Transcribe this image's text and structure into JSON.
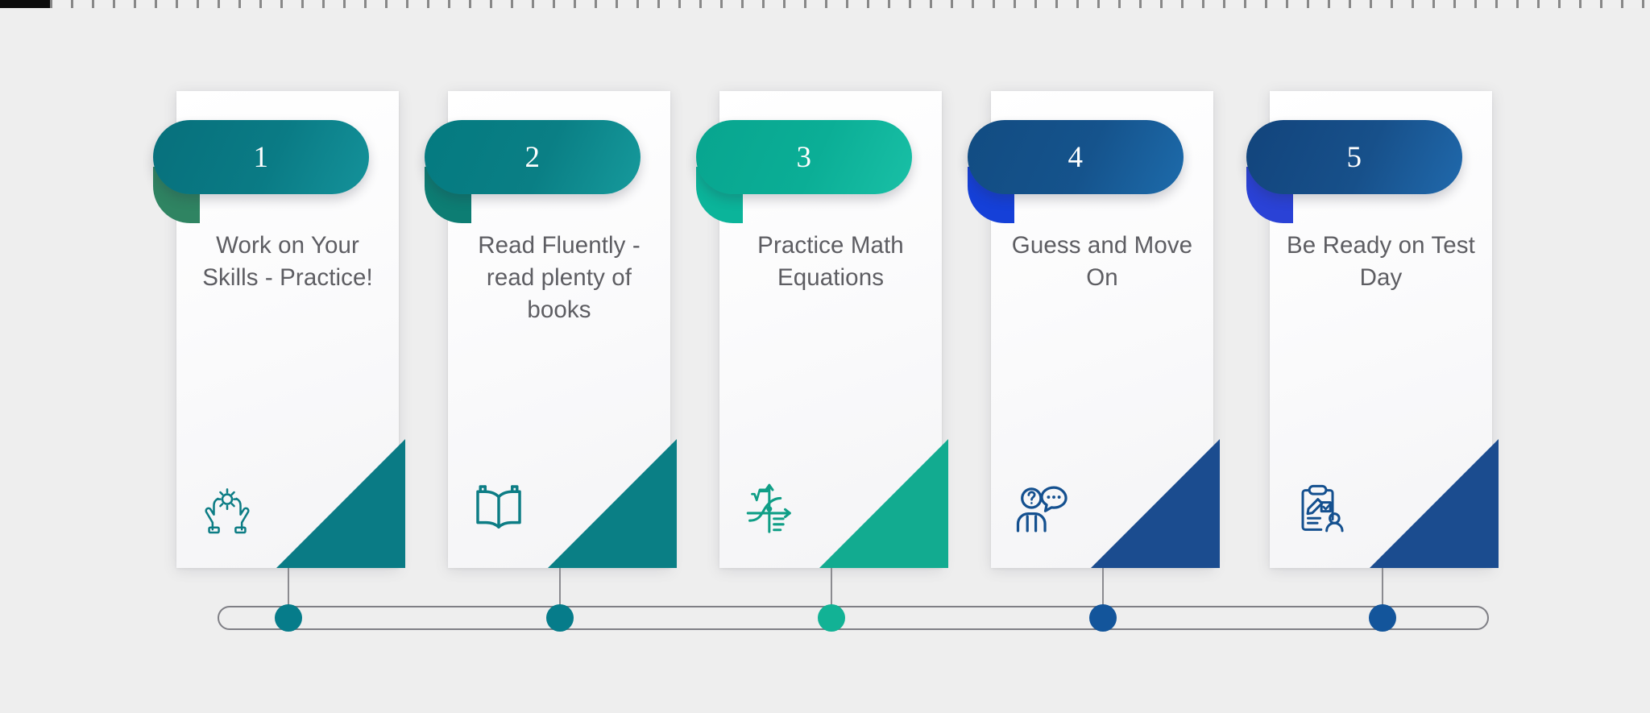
{
  "infographic": {
    "type": "5-step process timeline",
    "background_color": "#eeeeee",
    "steps": [
      {
        "number": "1",
        "title": "Work on Your Skills - Practice!",
        "icon": "hands-holding-gear-icon",
        "pill_color": "#0a7b85",
        "pill_dark": "#07707c",
        "pill_light": "#14929a",
        "fold_color": "#2f8462",
        "triangle_color": "#0a7b85",
        "dot_color": "#067c8a"
      },
      {
        "number": "2",
        "title": "Read Fluently - read plenty of books",
        "icon": "open-book-icon",
        "pill_color": "#0a7f85",
        "pill_dark": "#047a80",
        "pill_light": "#169a9c",
        "fold_color": "#0d7d73",
        "triangle_color": "#0a7f85",
        "dot_color": "#067c8a"
      },
      {
        "number": "3",
        "title": "Practice Math Equations",
        "icon": "math-graph-sqrt-icon",
        "pill_color": "#0bae96",
        "pill_dark": "#08a58f",
        "pill_light": "#19c0a6",
        "fold_color": "#0bb49a",
        "triangle_color": "#12ab90",
        "dot_color": "#12b295"
      },
      {
        "number": "4",
        "title": "Guess and Move On",
        "icon": "person-question-speech-bubble-icon",
        "pill_color": "#15538c",
        "pill_dark": "#124c82",
        "pill_light": "#1d6bab",
        "fold_color": "#1540d8",
        "triangle_color": "#1b4c8f",
        "dot_color": "#13559b"
      },
      {
        "number": "5",
        "title": "Be Ready on Test Day",
        "icon": "clipboard-checklist-person-icon",
        "pill_color": "#17508a",
        "pill_dark": "#12447c",
        "pill_light": "#2069ac",
        "fold_color": "#2a42d6",
        "triangle_color": "#1b4c8f",
        "dot_color": "#13559b"
      }
    ],
    "timeline": {
      "track_color": "#7f7f85",
      "connector_color": "#8b8b90"
    }
  }
}
